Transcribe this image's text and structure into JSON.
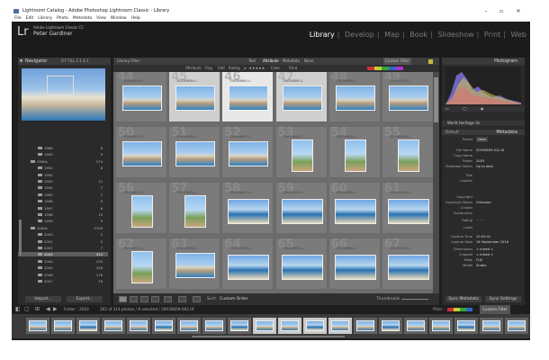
{
  "window": {
    "title": "Lightroom Catalog - Adobe Photoshop Lightroom Classic - Library",
    "minimize": "–",
    "maximize": "▫",
    "close": "✕"
  },
  "menu": [
    "File",
    "Edit",
    "Library",
    "Photo",
    "Metadata",
    "View",
    "Window",
    "Help"
  ],
  "identity": {
    "logo": "Lr",
    "app_name": "Adobe Lightroom Classic CC",
    "user": "Peter Gardiner"
  },
  "modules": [
    "Library",
    "Develop",
    "Map",
    "Book",
    "Slideshow",
    "Print",
    "Web"
  ],
  "active_module": "Library",
  "navigator": {
    "title": "Navigator",
    "options": "FIT   FILL   1:1   4:1"
  },
  "folders": [
    {
      "name": "1989",
      "count": "6"
    },
    {
      "name": "1990",
      "count": "9"
    },
    {
      "name": "1990s",
      "count": "174"
    },
    {
      "name": "1991",
      "count": "6"
    },
    {
      "name": "1992",
      "count": ""
    },
    {
      "name": "1993",
      "count": "12"
    },
    {
      "name": "1994",
      "count": "7"
    },
    {
      "name": "1995",
      "count": "7"
    },
    {
      "name": "1996",
      "count": "9"
    },
    {
      "name": "1997",
      "count": "6"
    },
    {
      "name": "1998",
      "count": "19"
    },
    {
      "name": "1999",
      "count": "9"
    },
    {
      "name": "2000s",
      "count": "2709"
    },
    {
      "name": "2000",
      "count": "2"
    },
    {
      "name": "2001",
      "count": "5"
    },
    {
      "name": "2002",
      "count": "7"
    },
    {
      "name": "2003",
      "count": "314"
    },
    {
      "name": "2004",
      "count": "135"
    },
    {
      "name": "2005",
      "count": "126"
    },
    {
      "name": "2006",
      "count": "176"
    },
    {
      "name": "2007",
      "count": "76"
    }
  ],
  "left_buttons": {
    "import": "Import...",
    "export": "Export..."
  },
  "library_filter": {
    "label": "Library Filter :",
    "tabs": [
      "Text",
      "Attribute",
      "Metadata",
      "None"
    ],
    "active_tab": "Attribute",
    "preset": "Custom Filter",
    "attribute_row": "Attribute   Flag     Edit   Rating   ≥  ★★★★★     Color        Kind"
  },
  "grid_numbers": [
    44,
    45,
    46,
    47,
    48,
    49,
    50,
    51,
    52,
    53,
    54,
    55,
    56,
    57,
    58,
    59,
    60,
    61,
    62,
    63,
    64,
    65,
    66,
    67,
    68,
    69,
    70,
    71,
    72,
    73
  ],
  "grid_file_label": "20030609-0...",
  "toolbar": {
    "sort_label": "Sort:",
    "sort_value": "Custom Order",
    "thumbnails_label": "Thumbnails"
  },
  "histogram": {
    "title": "Histogram"
  },
  "right_panel": {
    "quick_develop": "World Heritage 3x",
    "metadata_title": "Metadata",
    "default_label": "Default",
    "preset_label": "Preset",
    "preset_value": "None",
    "fields": [
      {
        "label": "File Name",
        "value": "20030609-012.tif"
      },
      {
        "label": "Copy Name",
        "value": ""
      },
      {
        "label": "Folder",
        "value": "2003"
      },
      {
        "label": "Metadata Status",
        "value": "Up to date"
      },
      {
        "label": "Title",
        "value": ""
      },
      {
        "label": "Caption",
        "value": ""
      },
      {
        "label": "Copyright",
        "value": ""
      },
      {
        "label": "Copyright Status",
        "value": "Unknown"
      },
      {
        "label": "Creator",
        "value": ""
      },
      {
        "label": "Sublocation",
        "value": ""
      },
      {
        "label": "Rating",
        "value": "· · · · ·"
      },
      {
        "label": "Label",
        "value": ""
      },
      {
        "label": "Capture Time",
        "value": "10:02:41"
      },
      {
        "label": "Capture Date",
        "value": "16 September 2018"
      },
      {
        "label": "Dimensions",
        "value": "< mixed >"
      },
      {
        "label": "Cropped",
        "value": "< mixed >"
      },
      {
        "label": "Make",
        "value": "FUJI"
      },
      {
        "label": "Model",
        "value": "Studio"
      }
    ],
    "sync_metadata": "Sync Metadata",
    "sync_settings": "Sync Settings"
  },
  "filmstrip_bar": {
    "source": "Folder : 2003",
    "count": "302 of 314 photos / 8 selected / 20030609-002.tif",
    "filter_label": "Filter :",
    "filter_value": "Custom Filter"
  }
}
